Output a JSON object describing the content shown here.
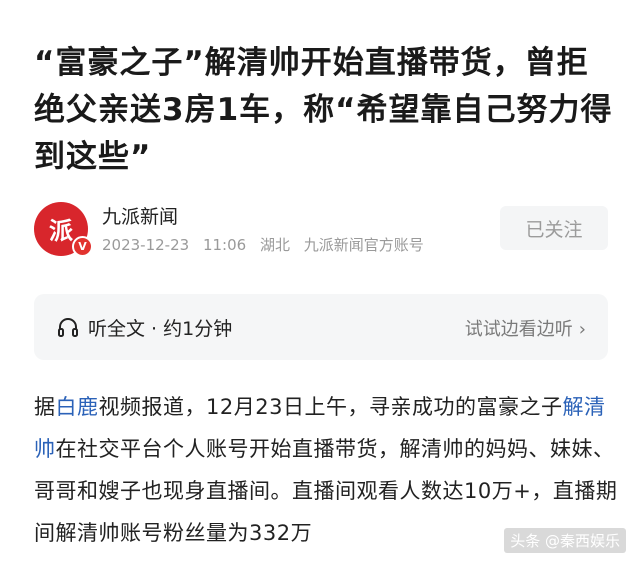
{
  "article": {
    "title": "“富豪之子”解清帅开始直播带货，曾拒绝父亲送3房1车，称“希望靠自己努力得到这些”"
  },
  "author": {
    "avatar_text": "派",
    "verified_mark": "V",
    "name": "九派新闻",
    "date": "2023-12-23",
    "time": "11:06",
    "location": "湖北",
    "account_type": "九派新闻官方账号",
    "follow_label": "已关注"
  },
  "listen": {
    "icon": "headphones-icon",
    "label": "听全文 · 约1分钟",
    "try_label": "试试边看边听",
    "chevron": "›"
  },
  "body": {
    "p1_a": "据",
    "p1_link1": "白鹿",
    "p1_b": "视频报道，12月23日上午，寻亲成功的富豪之子",
    "p1_link2": "解清帅",
    "p1_c": "在社交平台个人账号开始直播带货，解清帅的妈妈、妹妹、哥哥和嫂子也现身直播间。直播间观看人数达10万+，直播期间解清帅账号粉丝量为332万"
  },
  "watermark": "头条 @秦西娱乐",
  "colors": {
    "accent": "#d8262c",
    "link": "#2b62b8"
  }
}
